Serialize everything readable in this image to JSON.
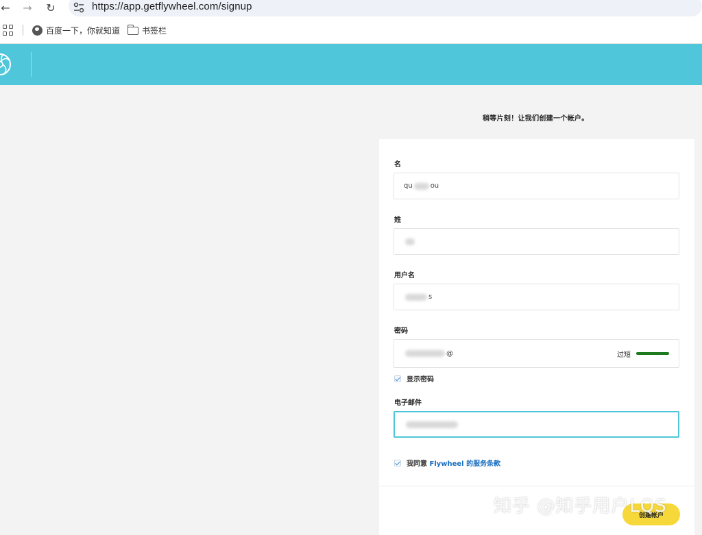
{
  "browser": {
    "url": "https://app.getflywheel.com/signup",
    "bookmarks": [
      {
        "label": "百度一下，你就知道",
        "icon": "globe-icon"
      },
      {
        "label": "书签栏",
        "icon": "folder-icon"
      }
    ]
  },
  "header": {
    "color": "#50c6db",
    "logo": "flywheel-logo"
  },
  "page": {
    "heading": "稍等片刻！让我们创建一个帐户。"
  },
  "form": {
    "first_name": {
      "label": "名",
      "value_prefix": "qu",
      "value_suffix": "ou"
    },
    "last_name": {
      "label": "姓"
    },
    "username": {
      "label": "用户名",
      "value_suffix": "s"
    },
    "password": {
      "label": "密码",
      "value_suffix": "@",
      "strength_label": "过短",
      "strength_color": "#1e7a1e"
    },
    "show_password": {
      "label": "显示密码",
      "checked": true
    },
    "email": {
      "label": "电子邮件"
    },
    "terms": {
      "prefix": "我同意 ",
      "brand": "Flywheel",
      "suffix": " 的服务条款",
      "checked": true
    },
    "submit_label": "创建帐户",
    "accent_color": "#f6d83a"
  },
  "watermark": "知乎 @知乎用户LQS"
}
